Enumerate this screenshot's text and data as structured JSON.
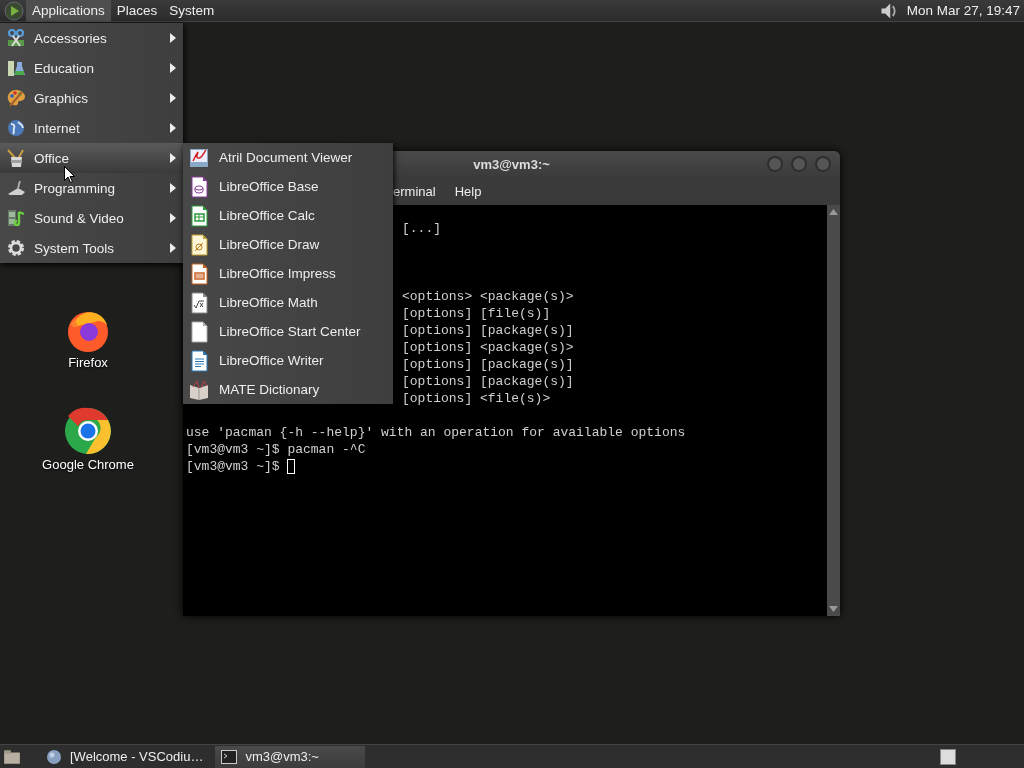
{
  "top_panel": {
    "menus": [
      {
        "label": "Applications",
        "selected": true
      },
      {
        "label": "Places",
        "selected": false
      },
      {
        "label": "System",
        "selected": false
      }
    ],
    "clock": "Mon Mar 27, 19:47"
  },
  "desktop_icons": [
    {
      "label": "Firefox"
    },
    {
      "label": "Google Chrome"
    }
  ],
  "terminal_window": {
    "title": "vm3@vm3:~",
    "menus": [
      "erminal",
      "Help"
    ],
    "lines": [
      {
        "kind": "covered",
        "text": "[...]"
      },
      {
        "kind": "blank"
      },
      {
        "kind": "blank"
      },
      {
        "kind": "blank"
      },
      {
        "kind": "covered",
        "text": "<options> <package(s)>"
      },
      {
        "kind": "covered",
        "text": "[options] [file(s)]"
      },
      {
        "kind": "covered",
        "text": "[options] [package(s)]"
      },
      {
        "kind": "covered",
        "text": "[options] <package(s)>"
      },
      {
        "kind": "covered",
        "text": "[options] [package(s)]"
      },
      {
        "kind": "covered",
        "text": "[options] [package(s)]"
      },
      {
        "kind": "covered",
        "text": "[options] <file(s)>"
      },
      {
        "kind": "blank"
      },
      {
        "kind": "full",
        "text": "use 'pacman {-h --help}' with an operation for available options"
      },
      {
        "kind": "full",
        "text": "[vm3@vm3 ~]$ pacman -^C"
      },
      {
        "kind": "prompt",
        "text": "[vm3@vm3 ~]$ "
      }
    ]
  },
  "applications_menu": {
    "items": [
      {
        "label": "Accessories",
        "selected": false
      },
      {
        "label": "Education",
        "selected": false
      },
      {
        "label": "Graphics",
        "selected": false
      },
      {
        "label": "Internet",
        "selected": false
      },
      {
        "label": "Office",
        "selected": true
      },
      {
        "label": "Programming",
        "selected": false
      },
      {
        "label": "Sound & Video",
        "selected": false
      },
      {
        "label": "System Tools",
        "selected": false
      }
    ]
  },
  "office_submenu": {
    "items": [
      {
        "label": "Atril Document Viewer"
      },
      {
        "label": "LibreOffice Base"
      },
      {
        "label": "LibreOffice Calc"
      },
      {
        "label": "LibreOffice Draw"
      },
      {
        "label": "LibreOffice Impress"
      },
      {
        "label": "LibreOffice Math"
      },
      {
        "label": "LibreOffice Start Center"
      },
      {
        "label": "LibreOffice Writer"
      },
      {
        "label": "MATE Dictionary"
      }
    ]
  },
  "taskbar": {
    "tasks": [
      {
        "label": "[Welcome - VSCodiu…",
        "selected": false
      },
      {
        "label": "vm3@vm3:~",
        "selected": true
      }
    ]
  }
}
